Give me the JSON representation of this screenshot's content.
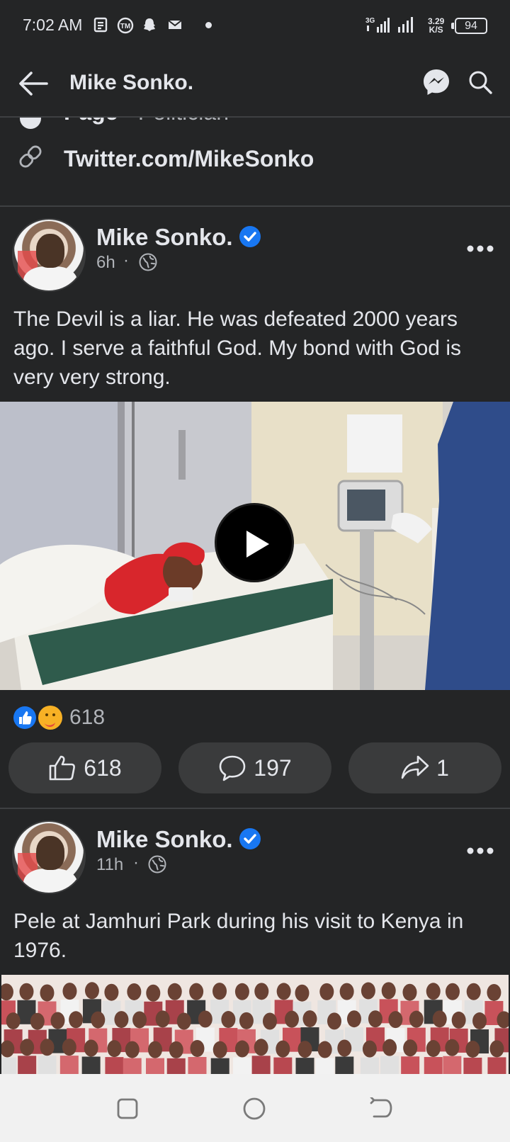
{
  "status_bar": {
    "time": "7:02 AM",
    "network": "3G",
    "speed_value": "3.29",
    "speed_unit": "K/S",
    "battery": "94"
  },
  "app_bar": {
    "title": "Mike Sonko.",
    "back_icon": "arrow-left-icon",
    "messenger_icon": "messenger-icon",
    "search_icon": "search-icon"
  },
  "info": {
    "category_label": "Page",
    "category_value": "Politician",
    "link": "Twitter.com/MikeSonko"
  },
  "posts": [
    {
      "author": "Mike Sonko.",
      "time": "6h",
      "text": "The Devil is a liar. He was defeated 2000 years ago. I serve a faithful God. My bond with God is very very strong.",
      "reaction_count": "618",
      "like_count": "618",
      "comment_count": "197",
      "share_count": "1"
    },
    {
      "author": "Mike Sonko.",
      "time": "11h",
      "text": "Pele at Jamhuri Park during his visit to Kenya in 1976."
    }
  ],
  "colors": {
    "background": "#242526",
    "text": "#e4e6eb",
    "secondary_text": "#b0b3b8",
    "button_bg": "#3a3b3c",
    "verified_blue": "#1877f2",
    "nav_bar": "#f1f1f1"
  }
}
